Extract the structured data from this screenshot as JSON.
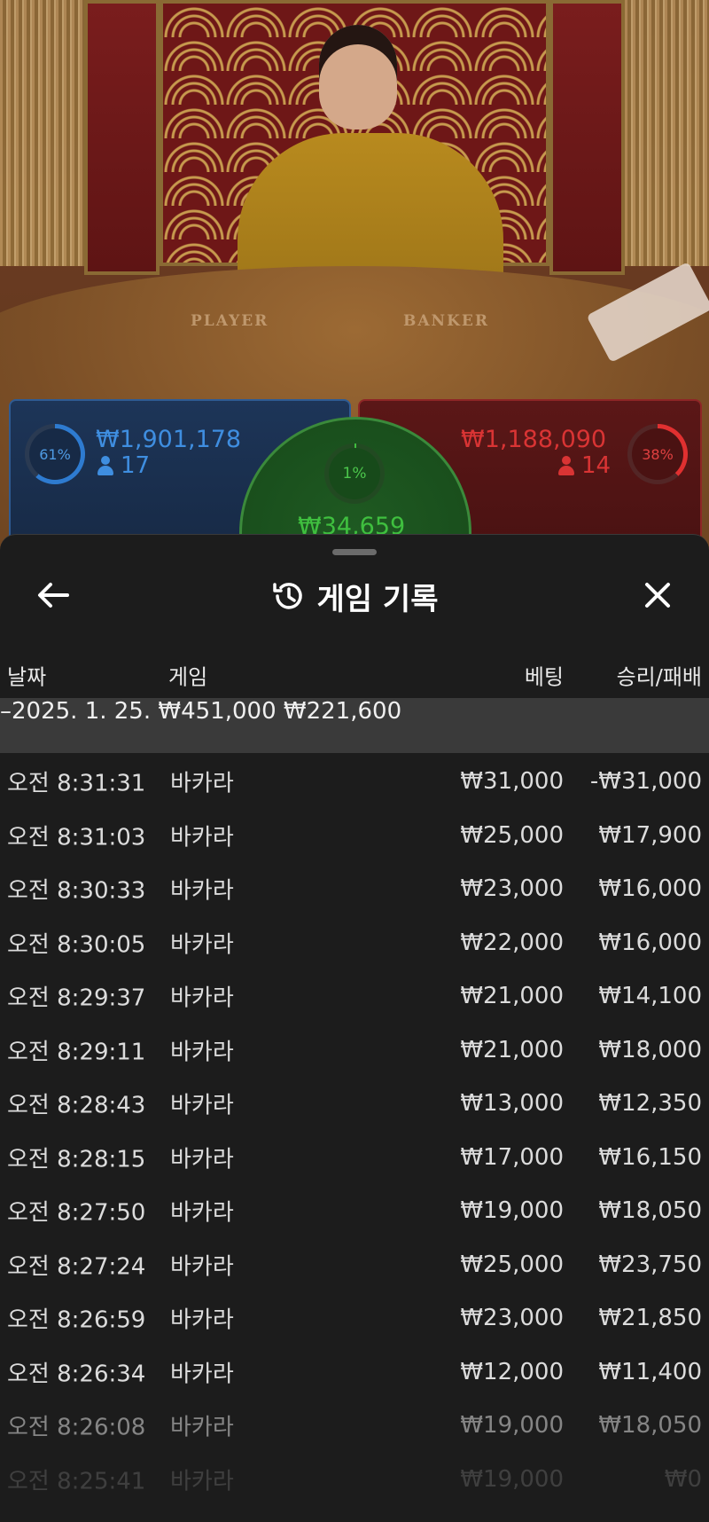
{
  "video": {
    "table_labels": {
      "player": "PLAYER",
      "banker": "BANKER"
    }
  },
  "bets": {
    "player": {
      "percent": "61%",
      "amount": "₩1,901,178",
      "players": "17",
      "color": "#3f8ee0"
    },
    "tie": {
      "percent": "1%",
      "amount": "₩34,659",
      "color": "#3fbf3f"
    },
    "banker": {
      "percent": "38%",
      "amount": "₩1,188,090",
      "players": "14",
      "color": "#d93434"
    }
  },
  "sheet": {
    "title": "게임 기록",
    "icons": {
      "back": "back-arrow-icon",
      "history": "history-icon",
      "close": "close-icon"
    },
    "columns": {
      "date": "날짜",
      "game": "게임",
      "bet": "베팅",
      "winloss": "승리/패배"
    },
    "date_group": {
      "label": "–2025. 1. 25.",
      "bet_total": "₩451,000",
      "winloss_total": "₩221,600"
    },
    "rows": [
      {
        "time": "오전 8:31:31",
        "game": "바카라",
        "bet": "₩31,000",
        "winloss": "-₩31,000"
      },
      {
        "time": "오전 8:31:03",
        "game": "바카라",
        "bet": "₩25,000",
        "winloss": "₩17,900"
      },
      {
        "time": "오전 8:30:33",
        "game": "바카라",
        "bet": "₩23,000",
        "winloss": "₩16,000"
      },
      {
        "time": "오전 8:30:05",
        "game": "바카라",
        "bet": "₩22,000",
        "winloss": "₩16,000"
      },
      {
        "time": "오전 8:29:37",
        "game": "바카라",
        "bet": "₩21,000",
        "winloss": "₩14,100"
      },
      {
        "time": "오전 8:29:11",
        "game": "바카라",
        "bet": "₩21,000",
        "winloss": "₩18,000"
      },
      {
        "time": "오전 8:28:43",
        "game": "바카라",
        "bet": "₩13,000",
        "winloss": "₩12,350"
      },
      {
        "time": "오전 8:28:15",
        "game": "바카라",
        "bet": "₩17,000",
        "winloss": "₩16,150"
      },
      {
        "time": "오전 8:27:50",
        "game": "바카라",
        "bet": "₩19,000",
        "winloss": "₩18,050"
      },
      {
        "time": "오전 8:27:24",
        "game": "바카라",
        "bet": "₩25,000",
        "winloss": "₩23,750"
      },
      {
        "time": "오전 8:26:59",
        "game": "바카라",
        "bet": "₩23,000",
        "winloss": "₩21,850"
      },
      {
        "time": "오전 8:26:34",
        "game": "바카라",
        "bet": "₩12,000",
        "winloss": "₩11,400"
      },
      {
        "time": "오전 8:26:08",
        "game": "바카라",
        "bet": "₩19,000",
        "winloss": "₩18,050"
      },
      {
        "time": "오전 8:25:41",
        "game": "바카라",
        "bet": "₩19,000",
        "winloss": "₩0"
      }
    ]
  }
}
